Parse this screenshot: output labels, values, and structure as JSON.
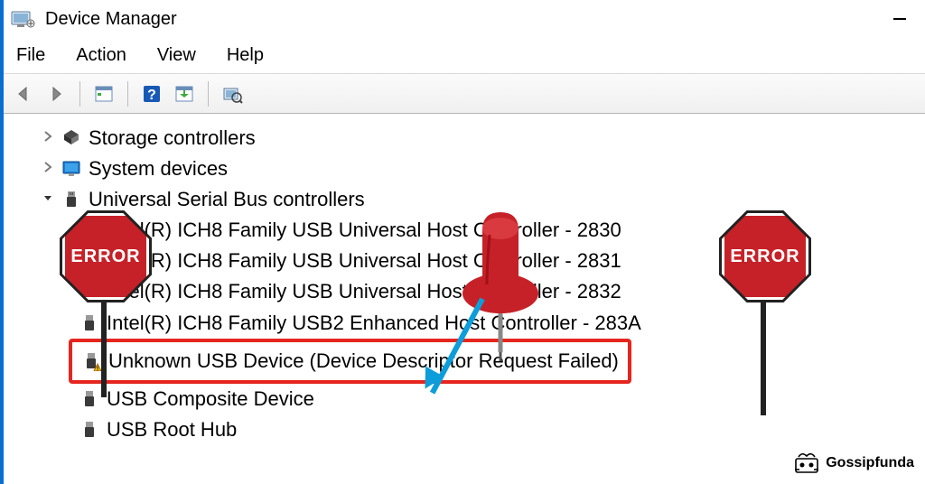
{
  "titlebar": {
    "title": "Device Manager"
  },
  "menu": {
    "file": "File",
    "action": "Action",
    "view": "View",
    "help": "Help"
  },
  "tree": {
    "storage": "Storage controllers",
    "system": "System devices",
    "usb_root": "Universal Serial Bus controllers",
    "items": [
      "Intel(R) ICH8 Family USB Universal Host Controller - 2830",
      "Intel(R) ICH8 Family USB Universal Host Controller - 2831",
      "Intel(R) ICH8 Family USB Universal Host Controller - 2832",
      "Intel(R) ICH8 Family USB2 Enhanced Host Controller - 283A",
      "Unknown USB Device (Device Descriptor Request Failed)",
      "USB Composite Device",
      "USB Root Hub"
    ]
  },
  "overlay": {
    "error_label": "ERROR"
  },
  "watermark": {
    "text": "Gossipfunda"
  }
}
